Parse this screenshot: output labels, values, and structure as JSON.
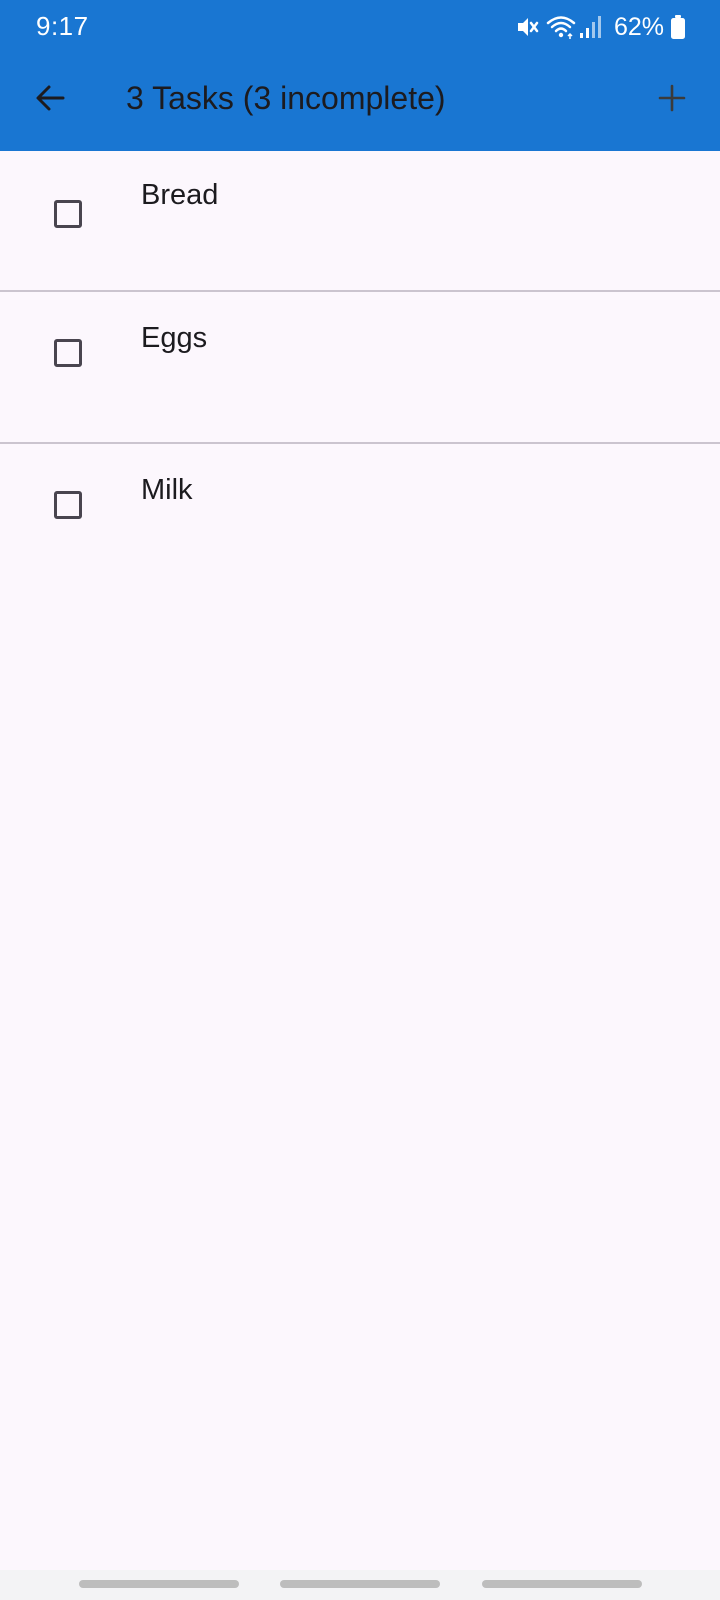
{
  "status_bar": {
    "time": "9:17",
    "battery": "62%",
    "icons": [
      "mute-icon",
      "wifi-icon",
      "signal-icon",
      "battery-icon"
    ]
  },
  "app_bar": {
    "title": "3 Tasks (3 incomplete)",
    "back_icon": "arrow-left-icon",
    "add_icon": "plus-icon",
    "color": "#1976d2"
  },
  "tasks": [
    {
      "label": "Bread",
      "checked": false
    },
    {
      "label": "Eggs",
      "checked": false
    },
    {
      "label": "Milk",
      "checked": false
    }
  ],
  "colors": {
    "background": "#fcf7fd",
    "divider": "#cbc4cf",
    "checkbox_border": "#49454f",
    "text": "#1c1b1f"
  }
}
